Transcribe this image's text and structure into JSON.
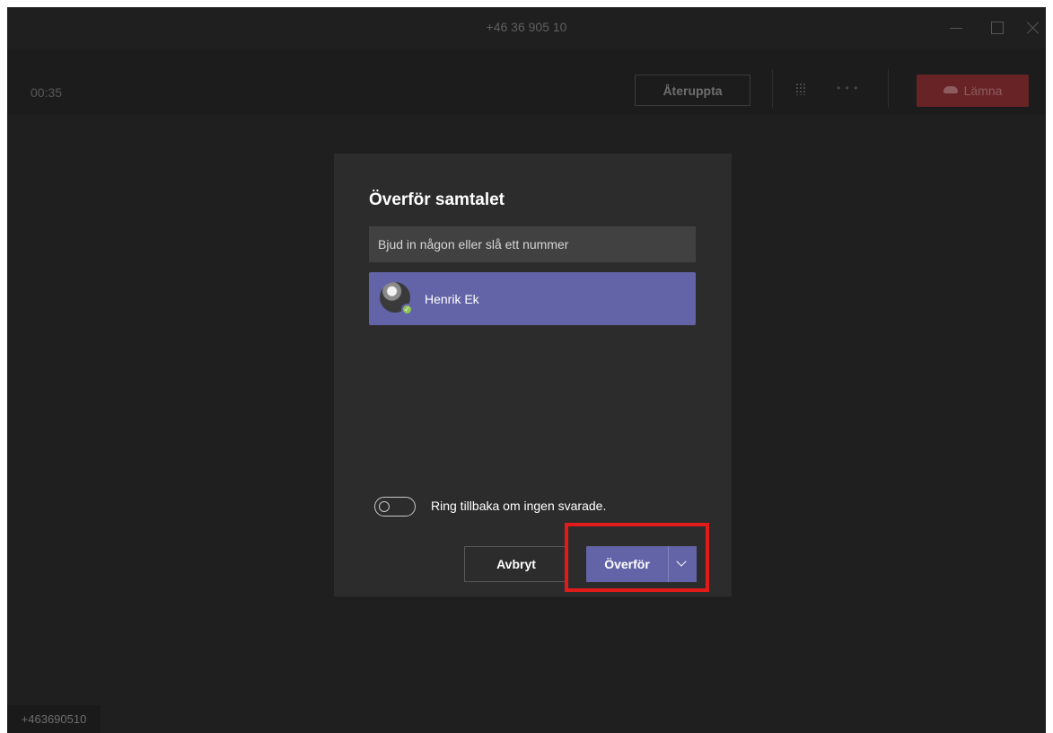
{
  "window": {
    "title": "+46 36 905 10"
  },
  "callbar": {
    "timer": "00:35",
    "resume_label": "Återuppta",
    "more_label": "• • •",
    "leave_label": "Lämna",
    "leave_color": "#682327"
  },
  "dialog": {
    "title": "Överför samtalet",
    "search_placeholder": "Bjud in någon eller slå ett nummer",
    "results": [
      {
        "name": "Henrik Ek",
        "presence": "available"
      }
    ],
    "callback_toggle": {
      "label": "Ring tillbaka om ingen svarade.",
      "on": false
    },
    "cancel_label": "Avbryt",
    "transfer_label": "Överför"
  },
  "footer": {
    "caller_id": "+463690510"
  },
  "colors": {
    "accent": "#6264a7",
    "highlight": "#e11a1a",
    "presence_available": "#92c353"
  }
}
